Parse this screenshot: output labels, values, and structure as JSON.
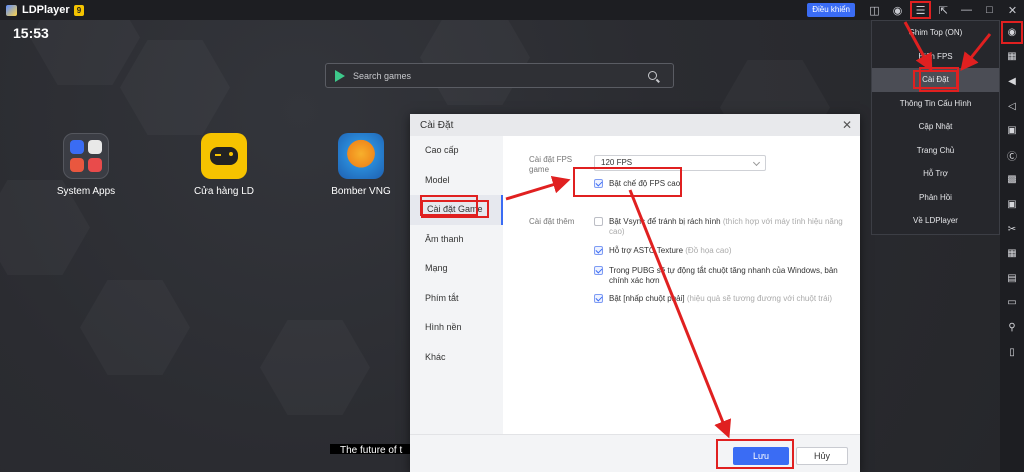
{
  "titlebar": {
    "app_name": "LDPlayer",
    "version_badge": "9",
    "control_button": "Điều khiển"
  },
  "desktop": {
    "clock": "15:53",
    "search_placeholder": "Search games",
    "apps": [
      {
        "label": "System Apps",
        "icon": "system-apps-icon"
      },
      {
        "label": "Cửa hàng LD",
        "icon": "ld-store-icon"
      },
      {
        "label": "Bomber VNG",
        "icon": "bomber-vng-icon"
      }
    ],
    "bottom_caption": "The future of t"
  },
  "menu": {
    "items": [
      {
        "label": "Ghim Top (ON)"
      },
      {
        "label": "Hiện FPS"
      },
      {
        "label": "Cài Đặt"
      },
      {
        "label": "Thông Tin Cấu Hình"
      },
      {
        "label": "Cập Nhật"
      },
      {
        "label": "Trang Chủ"
      },
      {
        "label": "Hỗ Trợ"
      },
      {
        "label": "Phản Hồi"
      },
      {
        "label": "Về LDPlayer"
      }
    ],
    "active_index": 2
  },
  "dialog": {
    "title": "Cài Đặt",
    "sidebar": [
      {
        "label": "Cao cấp"
      },
      {
        "label": "Model"
      },
      {
        "label": "Cài đặt Game"
      },
      {
        "label": "Âm thanh"
      },
      {
        "label": "Mạng"
      },
      {
        "label": "Phím tắt"
      },
      {
        "label": "Hình nền"
      },
      {
        "label": "Khác"
      }
    ],
    "active_tab_index": 2,
    "fps_label": "Cài đặt FPS game",
    "fps_value": "120 FPS",
    "high_fps_option": "Bật chế độ FPS cao",
    "extra_label": "Cài đặt thêm",
    "options": [
      {
        "text": "Bật Vsync để tránh bị rách hình",
        "hint": "(thích hợp với máy tính hiệu năng cao)",
        "checked": false
      },
      {
        "text": "Hỗ trợ ASTC Texture",
        "hint": "(Đồ họa cao)",
        "checked": true
      },
      {
        "text": "Trong PUBG sẽ tự động tắt chuột tăng nhanh của Windows, bản chính xác hơn",
        "hint": "",
        "checked": true
      },
      {
        "text": "Bật [nhấp chuột phải]",
        "hint": "(hiệu quả sẽ tương đương với chuột trái)",
        "checked": true
      }
    ],
    "save_button": "Lưu",
    "cancel_button": "Hủy"
  },
  "colors": {
    "accent": "#3a6cf4",
    "highlight": "#e02020",
    "menu_bg": "#26272c"
  }
}
